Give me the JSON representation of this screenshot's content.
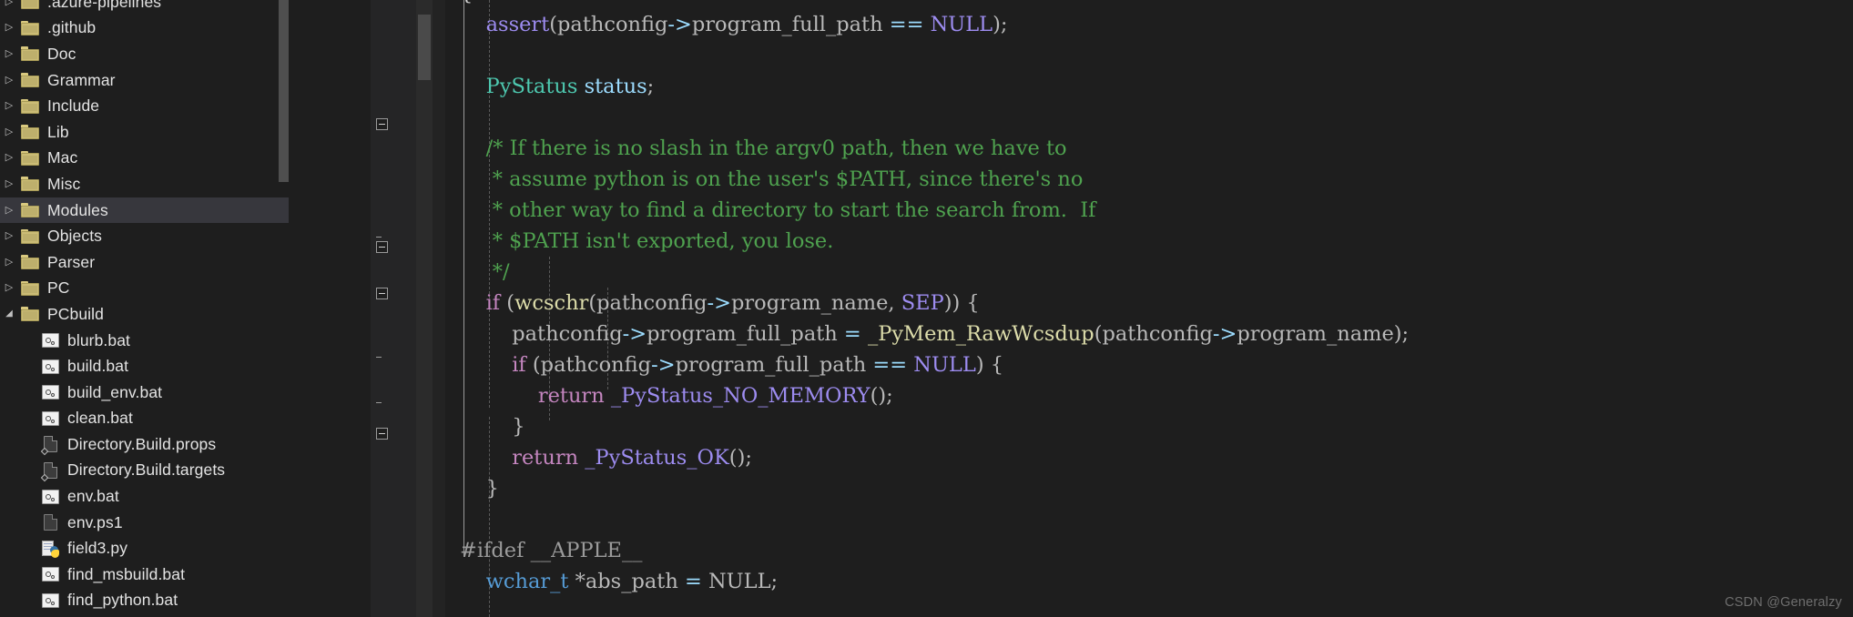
{
  "sidebar": {
    "scrollbar": {
      "name": "vertical-scrollbar"
    },
    "items": [
      {
        "label": ".azure-pipelines",
        "icon": "folder-icon",
        "kind": "folder",
        "indent": 0,
        "twisty": "collapsed",
        "selected": false
      },
      {
        "label": ".github",
        "icon": "folder-icon",
        "kind": "folder",
        "indent": 0,
        "twisty": "collapsed",
        "selected": false
      },
      {
        "label": "Doc",
        "icon": "folder-icon",
        "kind": "folder",
        "indent": 0,
        "twisty": "collapsed",
        "selected": false
      },
      {
        "label": "Grammar",
        "icon": "folder-icon",
        "kind": "folder",
        "indent": 0,
        "twisty": "collapsed",
        "selected": false
      },
      {
        "label": "Include",
        "icon": "folder-icon",
        "kind": "folder",
        "indent": 0,
        "twisty": "collapsed",
        "selected": false
      },
      {
        "label": "Lib",
        "icon": "folder-icon",
        "kind": "folder",
        "indent": 0,
        "twisty": "collapsed",
        "selected": false
      },
      {
        "label": "Mac",
        "icon": "folder-icon",
        "kind": "folder",
        "indent": 0,
        "twisty": "collapsed",
        "selected": false
      },
      {
        "label": "Misc",
        "icon": "folder-icon",
        "kind": "folder",
        "indent": 0,
        "twisty": "collapsed",
        "selected": false
      },
      {
        "label": "Modules",
        "icon": "folder-icon",
        "kind": "folder",
        "indent": 0,
        "twisty": "collapsed",
        "selected": true
      },
      {
        "label": "Objects",
        "icon": "folder-icon",
        "kind": "folder",
        "indent": 0,
        "twisty": "collapsed",
        "selected": false
      },
      {
        "label": "Parser",
        "icon": "folder-icon",
        "kind": "folder",
        "indent": 0,
        "twisty": "collapsed",
        "selected": false
      },
      {
        "label": "PC",
        "icon": "folder-icon",
        "kind": "folder",
        "indent": 0,
        "twisty": "collapsed",
        "selected": false
      },
      {
        "label": "PCbuild",
        "icon": "folder-icon",
        "kind": "folder",
        "indent": 0,
        "twisty": "expanded",
        "selected": false
      },
      {
        "label": "blurb.bat",
        "icon": "bat-file-icon",
        "kind": "bat",
        "indent": 1,
        "twisty": "none",
        "selected": false
      },
      {
        "label": "build.bat",
        "icon": "bat-file-icon",
        "kind": "bat",
        "indent": 1,
        "twisty": "none",
        "selected": false
      },
      {
        "label": "build_env.bat",
        "icon": "bat-file-icon",
        "kind": "bat",
        "indent": 1,
        "twisty": "none",
        "selected": false
      },
      {
        "label": "clean.bat",
        "icon": "bat-file-icon",
        "kind": "bat",
        "indent": 1,
        "twisty": "none",
        "selected": false
      },
      {
        "label": "Directory.Build.props",
        "icon": "xml-file-icon",
        "kind": "xml",
        "indent": 1,
        "twisty": "none",
        "selected": false
      },
      {
        "label": "Directory.Build.targets",
        "icon": "xml-file-icon",
        "kind": "xml",
        "indent": 1,
        "twisty": "none",
        "selected": false
      },
      {
        "label": "env.bat",
        "icon": "bat-file-icon",
        "kind": "bat",
        "indent": 1,
        "twisty": "none",
        "selected": false
      },
      {
        "label": "env.ps1",
        "icon": "generic-file-icon",
        "kind": "doc",
        "indent": 1,
        "twisty": "none",
        "selected": false
      },
      {
        "label": "field3.py",
        "icon": "python-file-icon",
        "kind": "py",
        "indent": 1,
        "twisty": "none",
        "selected": false
      },
      {
        "label": "find_msbuild.bat",
        "icon": "bat-file-icon",
        "kind": "bat",
        "indent": 1,
        "twisty": "none",
        "selected": false
      },
      {
        "label": "find_python.bat",
        "icon": "bat-file-icon",
        "kind": "bat",
        "indent": 1,
        "twisty": "none",
        "selected": false
      }
    ]
  },
  "editor": {
    "language": "c",
    "colors": {
      "background": "#1e1e1e",
      "comment": "#4FA24F",
      "keyword_control": "#c586c0",
      "constant": "#9d8cf0",
      "function": "#DCDCAA",
      "type": "#4EC9B0",
      "variable": "#9CDCFE",
      "plain": "#d4d4d4",
      "selection_row": "#37373d"
    },
    "lines": [
      "{",
      "    assert(pathconfig->program_full_path == NULL);",
      "",
      "    PyStatus status;",
      "",
      "    /* If there is no slash in the argv0 path, then we have to",
      "     * assume python is on the user's $PATH, since there's no",
      "     * other way to find a directory to start the search from.  If",
      "     * $PATH isn't exported, you lose.",
      "     */",
      "    if (wcschr(pathconfig->program_name, SEP)) {",
      "        pathconfig->program_full_path = _PyMem_RawWcsdup(pathconfig->program_name);",
      "        if (pathconfig->program_full_path == NULL) {",
      "            return _PyStatus_NO_MEMORY();",
      "        }",
      "        return _PyStatus_OK();",
      "    }",
      "",
      "#ifdef __APPLE__",
      "    wchar_t *abs_path = NULL;"
    ]
  },
  "watermark": {
    "text": "CSDN @Generalzy"
  }
}
